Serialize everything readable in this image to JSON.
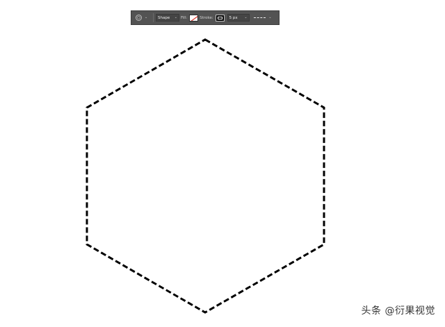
{
  "toolbar": {
    "tool_icon": "polygon-tool-icon",
    "caret": "⌄",
    "mode_value": "Shape",
    "fill_label": "Fill:",
    "fill_swatch": {
      "color": "#ffffff",
      "none_slash_color": "#e0352b"
    },
    "stroke_label": "Stroke:",
    "stroke_swatch": {
      "color": "#000000"
    },
    "stroke_width_value": "5 px"
  },
  "shape": {
    "type": "hexagon",
    "stroke_color": "#000000",
    "fill": "none",
    "stroke_style": "dashed"
  },
  "watermark": {
    "text": "头条 @衍果视觉"
  }
}
